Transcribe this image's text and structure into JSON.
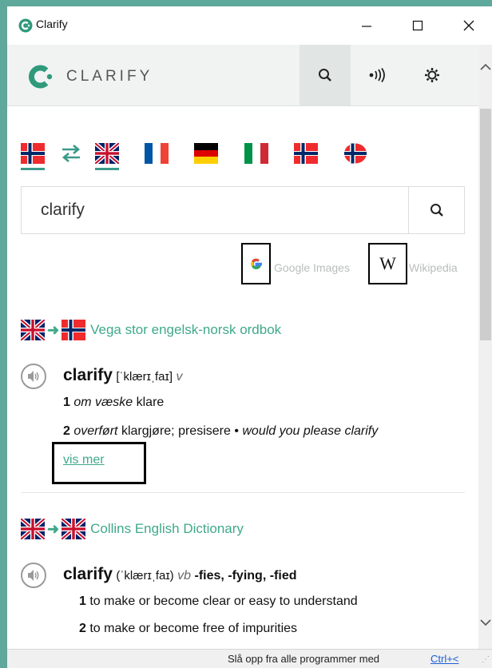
{
  "window": {
    "title": "Clarify"
  },
  "window_controls": {
    "minimize": "—",
    "maximize": "☐",
    "close": "✕"
  },
  "header": {
    "logo_text": "CLARIFY"
  },
  "search": {
    "value": "clarify",
    "placeholder": ""
  },
  "external": {
    "google_label": "Google Images",
    "wikipedia_label": "Wikipedia",
    "wiki_glyph": "W"
  },
  "languages": [
    "norwegian",
    "swap",
    "english",
    "french",
    "german",
    "italian",
    "icelandic",
    "faroese"
  ],
  "dict1": {
    "name": "Vega stor engelsk-norsk ordbok",
    "headword": "clarify",
    "phonetic": "[ˈklærɪˌfaɪ]",
    "pos": "v",
    "sense1_num": "1",
    "sense1_label": "om væske",
    "sense1_text": "klare",
    "sense2_num": "2",
    "sense2_label": "overført",
    "sense2_text": "klargjøre; presisere •",
    "sense2_example": "would you please clarify",
    "more": "vis mer"
  },
  "dict2": {
    "name": "Collins English Dictionary",
    "headword": "clarify",
    "phonetic": "(ˈklærɪˌfaɪ)",
    "pos": "vb",
    "forms": "-fies, -fying, -fied",
    "sense1_num": "1",
    "sense1_text": "to make or become clear or easy to understand",
    "sense2_num": "2",
    "sense2_text": "to make or become free of impurities"
  },
  "status": {
    "text": "Slå opp fra alle programmer med",
    "shortcut": "Ctrl+<"
  },
  "colors": {
    "accent": "#3fa98a",
    "frame": "#5fa89c"
  }
}
